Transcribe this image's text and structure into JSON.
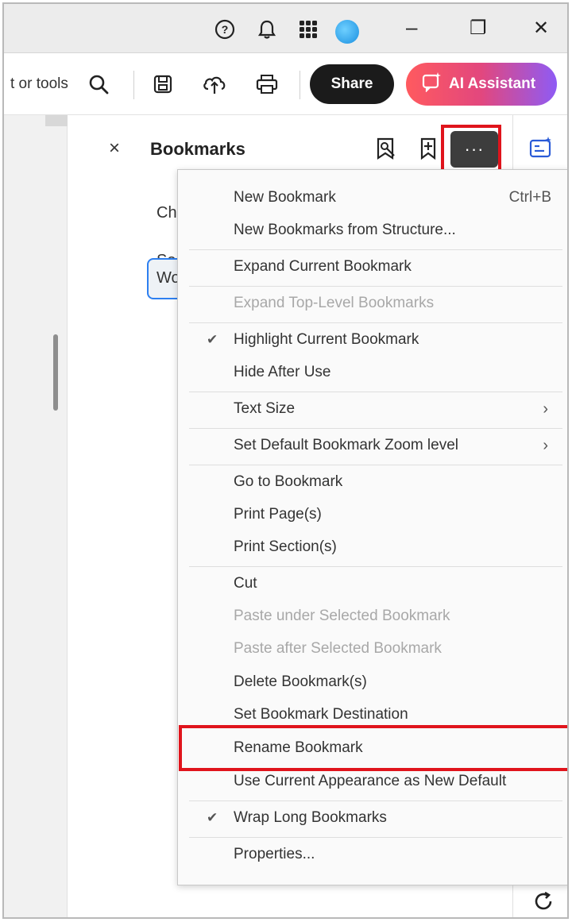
{
  "titlebar": {
    "help_icon": "question-circle-icon",
    "bell_icon": "bell-icon",
    "apps_icon": "apps-grid-icon",
    "minimize": "–",
    "restore": "❐",
    "close": "✕"
  },
  "toolbar": {
    "search_text": "t or tools",
    "share_label": "Share",
    "ai_label": "AI Assistant"
  },
  "panel": {
    "title": "Bookmarks",
    "close": "×",
    "more": "···",
    "items": [
      "Ch",
      "Se"
    ],
    "selected_item": "Wo"
  },
  "menu": {
    "items": [
      {
        "label": "New Bookmark",
        "shortcut": "Ctrl+B",
        "check": "",
        "submenu": "",
        "disabled": false
      },
      {
        "label": "New Bookmarks from Structure...",
        "shortcut": "",
        "check": "",
        "submenu": "",
        "disabled": false
      },
      {
        "label": "Expand Current Bookmark",
        "shortcut": "",
        "check": "",
        "submenu": "",
        "disabled": false
      },
      {
        "label": "Expand Top-Level Bookmarks",
        "shortcut": "",
        "check": "",
        "submenu": "",
        "disabled": true
      },
      {
        "label": "Highlight Current Bookmark",
        "shortcut": "",
        "check": "✔",
        "submenu": "",
        "disabled": false
      },
      {
        "label": "Hide After Use",
        "shortcut": "",
        "check": "",
        "submenu": "",
        "disabled": false
      },
      {
        "label": "Text Size",
        "shortcut": "",
        "check": "",
        "submenu": "›",
        "disabled": false
      },
      {
        "label": "Set Default Bookmark Zoom level",
        "shortcut": "",
        "check": "",
        "submenu": "›",
        "disabled": false
      },
      {
        "label": "Go to Bookmark",
        "shortcut": "",
        "check": "",
        "submenu": "",
        "disabled": false
      },
      {
        "label": "Print Page(s)",
        "shortcut": "",
        "check": "",
        "submenu": "",
        "disabled": false
      },
      {
        "label": "Print Section(s)",
        "shortcut": "",
        "check": "",
        "submenu": "",
        "disabled": false
      },
      {
        "label": "Cut",
        "shortcut": "",
        "check": "",
        "submenu": "",
        "disabled": false
      },
      {
        "label": "Paste under Selected Bookmark",
        "shortcut": "",
        "check": "",
        "submenu": "",
        "disabled": true
      },
      {
        "label": "Paste after Selected Bookmark",
        "shortcut": "",
        "check": "",
        "submenu": "",
        "disabled": true
      },
      {
        "label": "Delete Bookmark(s)",
        "shortcut": "",
        "check": "",
        "submenu": "",
        "disabled": false
      },
      {
        "label": "Set Bookmark Destination",
        "shortcut": "",
        "check": "",
        "submenu": "",
        "disabled": false
      },
      {
        "label": "Rename Bookmark",
        "shortcut": "",
        "check": "",
        "submenu": "",
        "disabled": false
      },
      {
        "label": "Use Current Appearance as New Default",
        "shortcut": "",
        "check": "",
        "submenu": "",
        "disabled": false
      },
      {
        "label": "Wrap Long Bookmarks",
        "shortcut": "",
        "check": "✔",
        "submenu": "",
        "disabled": false
      },
      {
        "label": "Properties...",
        "shortcut": "",
        "check": "",
        "submenu": "",
        "disabled": false
      }
    ]
  },
  "colors": {
    "highlight_red": "#e0141c",
    "selection_blue": "#2d7ff0",
    "share_bg": "#1b1b1b"
  }
}
